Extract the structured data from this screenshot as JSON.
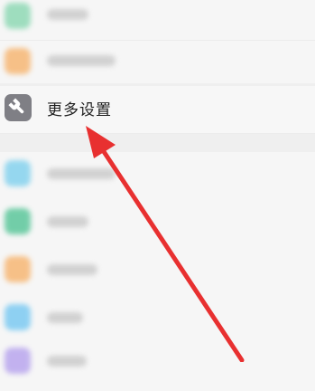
{
  "settings_list": {
    "highlighted_item": {
      "label": "更多设置",
      "icon": "wrench-icon",
      "icon_bg": "#7f7f85"
    },
    "blurred_item_colors": [
      "#8fd9b5",
      "#f7b774",
      "#85d2ee",
      "#5cc79b",
      "#f7b774",
      "#7ccaf2",
      "#b9a6ee"
    ]
  },
  "annotation": {
    "arrow_color": "#e83030"
  }
}
